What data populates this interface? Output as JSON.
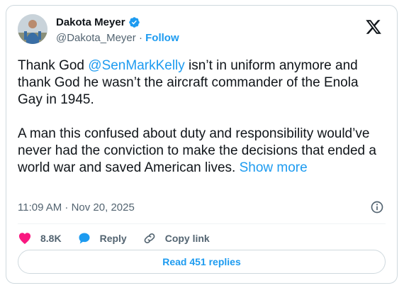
{
  "author": {
    "name": "Dakota Meyer",
    "handle": "@Dakota_Meyer",
    "separator": "·",
    "follow_label": "Follow",
    "verified_color": "#1d9bf0"
  },
  "tweet": {
    "text_start": "Thank God ",
    "mention": "@SenMarkKelly",
    "text_mid": " isn’t in uniform anymore and thank God he wasn’t the aircraft commander of the Enola Gay in 1945.\n\nA man this confused about duty and responsibility would’ve never had the conviction to make the decisions that ended a world war and saved American lives. ",
    "show_more": "Show more"
  },
  "meta": {
    "timestamp": "11:09 AM · Nov 20, 2025"
  },
  "actions": {
    "likes": "8.8K",
    "reply_label": "Reply",
    "copy_link_label": "Copy link"
  },
  "footer": {
    "read_replies_label": "Read 451 replies"
  },
  "colors": {
    "accent": "#1d9bf0",
    "like": "#f91880",
    "muted": "#536471"
  },
  "icons": [
    "verified-badge-icon",
    "x-logo-icon",
    "info-icon",
    "heart-icon",
    "reply-bubble-icon",
    "link-icon"
  ]
}
